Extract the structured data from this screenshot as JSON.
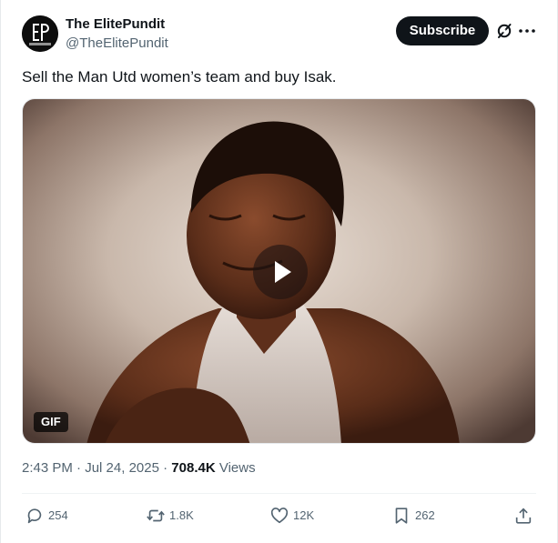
{
  "author": {
    "name": "The ElitePundit",
    "handle": "@TheElitePundit",
    "avatar_initials": "EP"
  },
  "header": {
    "subscribe_label": "Subscribe"
  },
  "tweet": {
    "text": "Sell the Man Utd women’s team and buy Isak."
  },
  "media": {
    "type_badge": "GIF"
  },
  "meta": {
    "time": "2:43 PM",
    "date": "Jul 24, 2025",
    "views_count": "708.4K",
    "views_label": "Views"
  },
  "actions": {
    "replies": "254",
    "reposts": "1.8K",
    "likes": "12K",
    "bookmarks": "262"
  },
  "colors": {
    "text_primary": "#0f1419",
    "text_secondary": "#536471",
    "button_dark": "#0f1419"
  }
}
